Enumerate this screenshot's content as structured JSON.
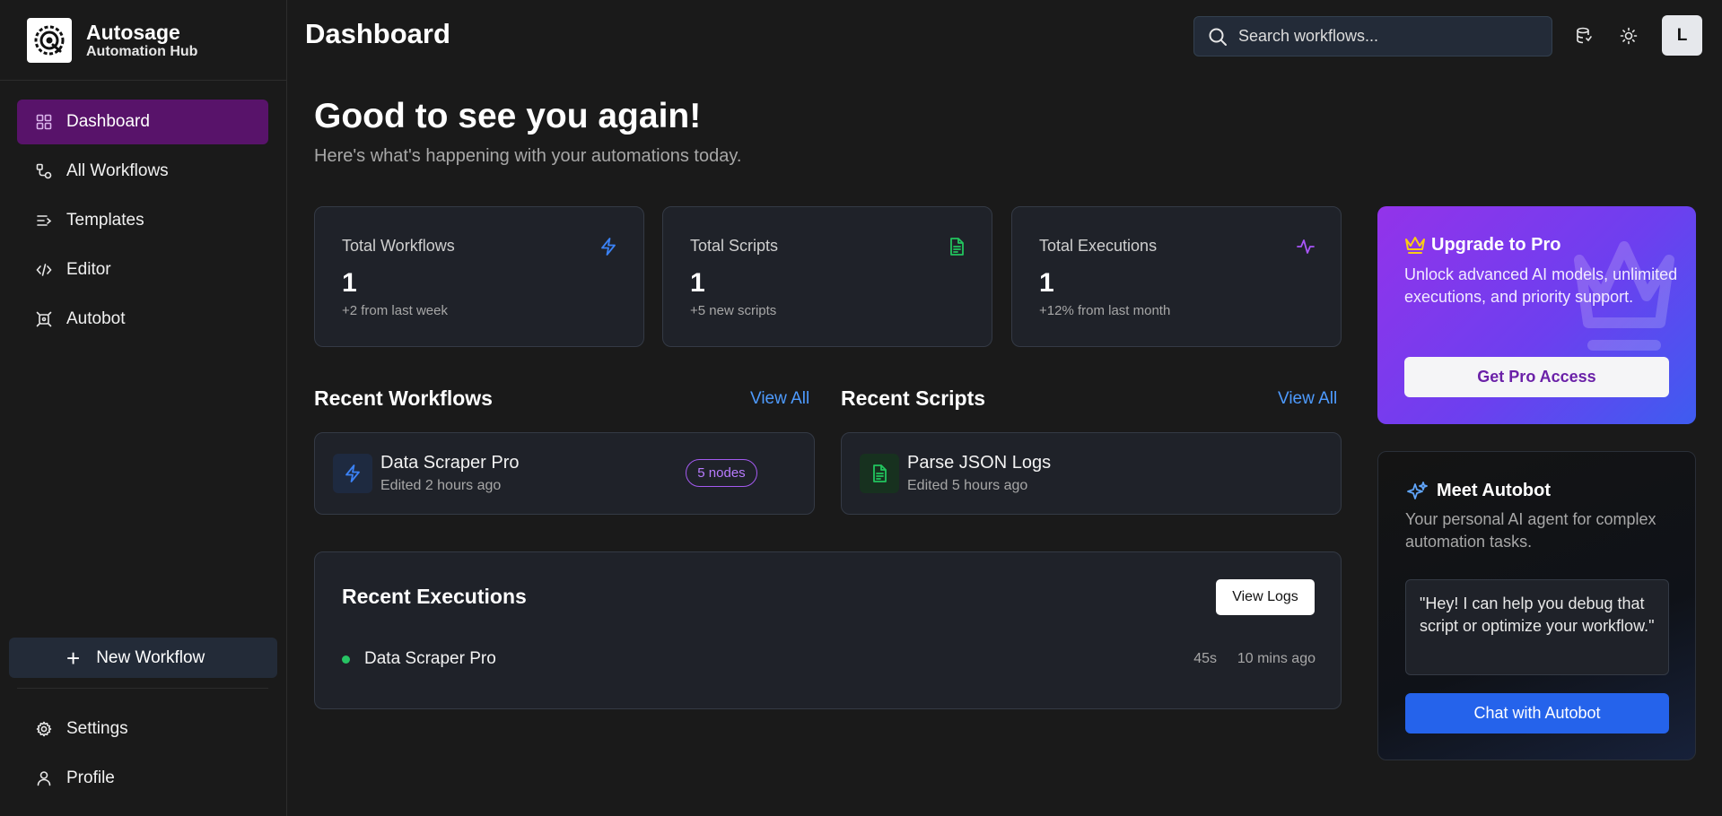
{
  "brand": {
    "name": "Autosage",
    "subtitle": "Automation Hub"
  },
  "sidebar": {
    "items": [
      {
        "label": "Dashboard",
        "icon": "grid-icon",
        "active": true
      },
      {
        "label": "All Workflows",
        "icon": "workflow-icon"
      },
      {
        "label": "Templates",
        "icon": "list-icon"
      },
      {
        "label": "Editor",
        "icon": "code-icon"
      },
      {
        "label": "Autobot",
        "icon": "bot-icon"
      }
    ],
    "new_workflow": "New Workflow",
    "bottom": [
      {
        "label": "Settings",
        "icon": "gear-icon"
      },
      {
        "label": "Profile",
        "icon": "user-icon"
      }
    ]
  },
  "header": {
    "title": "Dashboard",
    "search_placeholder": "Search workflows...",
    "avatar": "L"
  },
  "hero": {
    "title": "Good to see you again!",
    "subtitle": "Here's what's happening with your automations today."
  },
  "stats": [
    {
      "label": "Total Workflows",
      "value": "1",
      "note": "+2 from last week",
      "icon": "bolt-icon",
      "color": "#3b82f6"
    },
    {
      "label": "Total Scripts",
      "value": "1",
      "note": "+5 new scripts",
      "icon": "file-icon",
      "color": "#22c55e"
    },
    {
      "label": "Total Executions",
      "value": "1",
      "note": "+12% from last month",
      "icon": "activity-icon",
      "color": "#a855f7"
    }
  ],
  "recent_workflows": {
    "title": "Recent Workflows",
    "view_all": "View All",
    "items": [
      {
        "name": "Data Scraper Pro",
        "edited": "Edited 2 hours ago",
        "badge": "5 nodes"
      }
    ]
  },
  "recent_scripts": {
    "title": "Recent Scripts",
    "view_all": "View All",
    "items": [
      {
        "name": "Parse JSON Logs",
        "edited": "Edited 5 hours ago"
      }
    ]
  },
  "executions": {
    "title": "Recent Executions",
    "view_logs": "View Logs",
    "rows": [
      {
        "name": "Data Scraper Pro",
        "duration": "45s",
        "time": "10 mins ago",
        "status_color": "#27c464"
      }
    ]
  },
  "upgrade": {
    "title": "Upgrade to Pro",
    "description": "Unlock advanced AI models, unlimited executions, and priority support.",
    "button": "Get Pro Access"
  },
  "autobot": {
    "title": "Meet Autobot",
    "description": "Your personal AI agent for complex automation tasks.",
    "quote": "\"Hey! I can help you debug that script or optimize your workflow.\"",
    "button": "Chat with Autobot"
  }
}
